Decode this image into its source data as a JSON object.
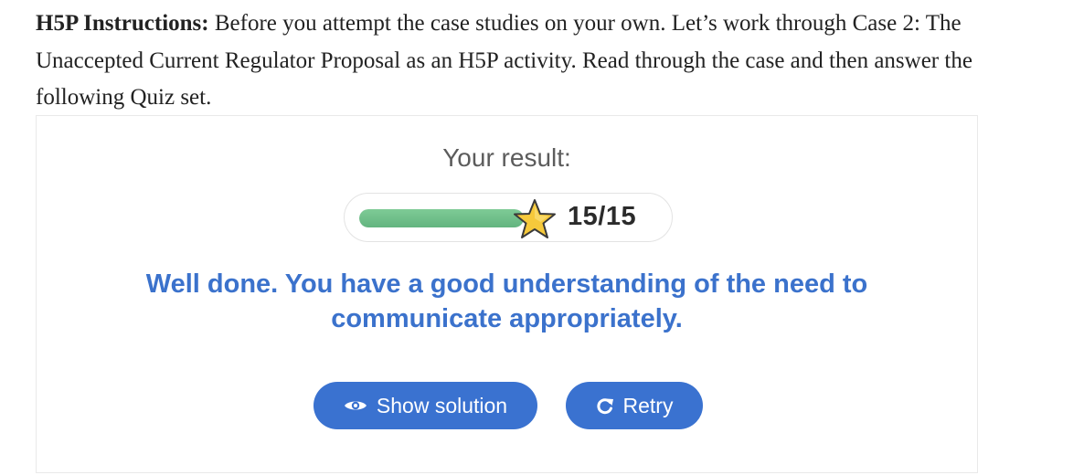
{
  "instructions": {
    "label": "H5P Instructions:",
    "text": " Before you attempt the case studies on your own. Let’s work through Case 2: The Unaccepted Current Regulator Proposal as an H5P activity. Read through the case and then answer the following Quiz set."
  },
  "result": {
    "label": "Your result:",
    "score_display": "15/15",
    "score": 15,
    "max_score": 15,
    "progress_fraction": 1.0,
    "icon": "star-icon"
  },
  "feedback": "Well done. You have a good understanding of the need to communicate appropriately.",
  "buttons": {
    "show_solution": {
      "label": "Show solution",
      "icon": "eye-icon"
    },
    "retry": {
      "label": "Retry",
      "icon": "retry-icon"
    }
  },
  "colors": {
    "accent": "#3a72d0",
    "feedback": "#3b72cc",
    "progress": "#6fc08a",
    "star": "#f6c93b"
  }
}
